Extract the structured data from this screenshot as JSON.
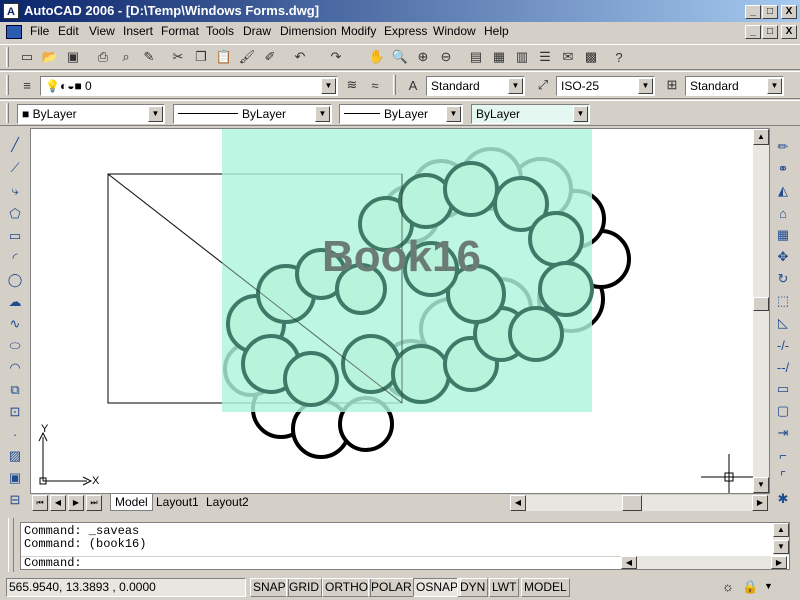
{
  "window": {
    "title": "AutoCAD 2006 - [D:\\Temp\\Windows Forms.dwg]",
    "app_icon": "autocad-icon",
    "caption_minimize": "_",
    "caption_restore": "□",
    "caption_close": "X"
  },
  "menu": {
    "items": [
      "File",
      "Edit",
      "View",
      "Insert",
      "Format",
      "Tools",
      "Draw",
      "Dimension",
      "Modify",
      "Express",
      "Window",
      "Help"
    ]
  },
  "layers": {
    "current_layer": "0",
    "text_style": "Standard",
    "dim_style": "ISO-25",
    "table_style": "Standard"
  },
  "properties": {
    "color": "ByLayer",
    "linetype": "ByLayer",
    "lineweight": "ByLayer",
    "plotstyle": "ByLayer"
  },
  "drawing": {
    "overlay_text": "Book16",
    "overlay_color": "#aef5dd",
    "ucs_x_label": "X",
    "ucs_y_label": "Y"
  },
  "layout_tabs": [
    "Model",
    "Layout1",
    "Layout2"
  ],
  "command": {
    "line1": "Command: _saveas",
    "line2": "Command: (book16)",
    "prompt": "Command:"
  },
  "status": {
    "coordinates": "565.9540, 13.3893 , 0.0000",
    "toggles": [
      "SNAP",
      "GRID",
      "ORTHO",
      "POLAR",
      "OSNAP",
      "DYN",
      "LWT",
      "MODEL"
    ]
  }
}
